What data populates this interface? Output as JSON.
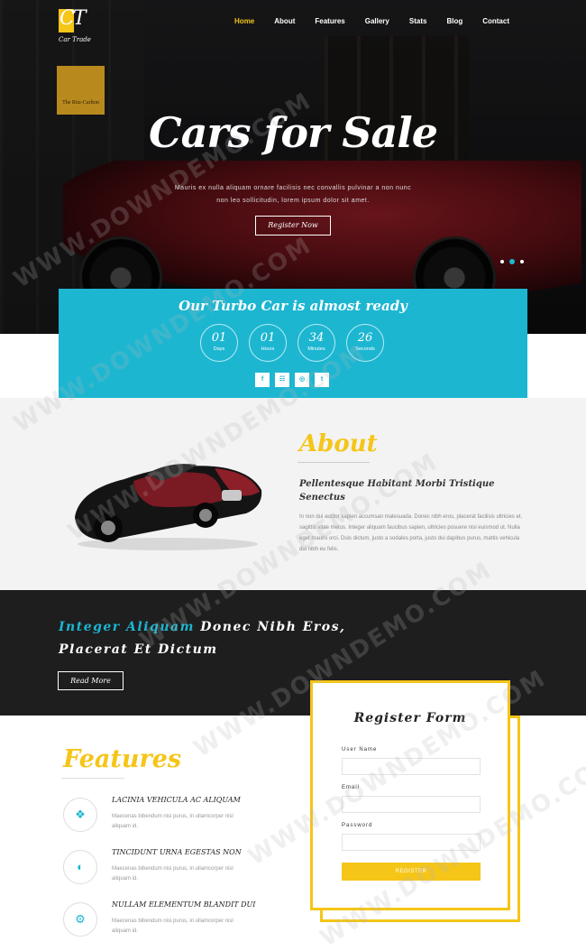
{
  "brand": {
    "logo_letters": "CT",
    "tagline": "Car Trade"
  },
  "nav": {
    "items": [
      {
        "label": "Home",
        "active": true
      },
      {
        "label": "About",
        "active": false
      },
      {
        "label": "Features",
        "active": false
      },
      {
        "label": "Gallery",
        "active": false
      },
      {
        "label": "Stats",
        "active": false
      },
      {
        "label": "Blog",
        "active": false
      },
      {
        "label": "Contact",
        "active": false
      }
    ]
  },
  "hero": {
    "sign_text": "The Ritz-Carlton",
    "title": "Cars for Sale",
    "text": "Mauris ex nulla aliquam ornare facilisis nec convallis pulvinar a non nunc non leo sollicitudin, lorem ipsum dolor sit amet.",
    "button": "Register Now",
    "slides": 3,
    "active_slide": 2
  },
  "countdown": {
    "title": "Our Turbo Car is almost ready",
    "items": [
      {
        "value": "01",
        "label": "Days"
      },
      {
        "value": "01",
        "label": "Hours"
      },
      {
        "value": "34",
        "label": "Minutes"
      },
      {
        "value": "26",
        "label": "Seconds"
      }
    ],
    "social": [
      {
        "icon": "facebook-icon",
        "glyph": "f"
      },
      {
        "icon": "rss-icon",
        "glyph": "☷"
      },
      {
        "icon": "instagram-icon",
        "glyph": "◎"
      },
      {
        "icon": "tumblr-icon",
        "glyph": "t"
      }
    ]
  },
  "about": {
    "title": "About",
    "subtitle": "Pellentesque Habitant Morbi Tristique Senectus",
    "text": "In non dui auctor sapien accumsan malesuada. Donec nibh eros, placerat facilisis ultricies et, sagittis vitae metus. Integer aliquam faucibus sapien, ultricies posuere nisl euismod ut. Nulla eget mauris orci. Duis dictum, justo a sodales porta, justo dui dapibus purus, mattis vehicula dui nibh eu felis."
  },
  "promo": {
    "title_highlight": "Integer Aliquam",
    "title_rest": "Donec Nibh Eros, Placerat Et Dictum",
    "button": "Read More"
  },
  "features": {
    "title": "Features",
    "items": [
      {
        "icon": "cubes-icon",
        "glyph": "❖",
        "title": "LACINIA VEHICULA AC ALIQUAM",
        "text": "Maecenas bibendum nisi purus, in ullamcorper nisl aliquam id."
      },
      {
        "icon": "globe-icon",
        "glyph": "◐",
        "title": "TINCIDUNT URNA EGESTAS NON",
        "text": "Maecenas bibendum nisi purus, in ullamcorper nisl aliquam id."
      },
      {
        "icon": "gear-icon",
        "glyph": "⚙",
        "title": "NULLAM ELEMENTUM BLANDIT DUI",
        "text": "Maecenas bibendum nisi purus, in ullamcorper nisl aliquam id."
      }
    ]
  },
  "register": {
    "title": "Register Form",
    "username_label": "User Name",
    "email_label": "Email",
    "password_label": "Password",
    "submit": "REGISTER"
  },
  "watermark": "WWW.DOWNDEMO.COM",
  "colors": {
    "accent_yellow": "#f5c518",
    "accent_cyan": "#1cb6d1",
    "dark": "#1e1e1f"
  }
}
